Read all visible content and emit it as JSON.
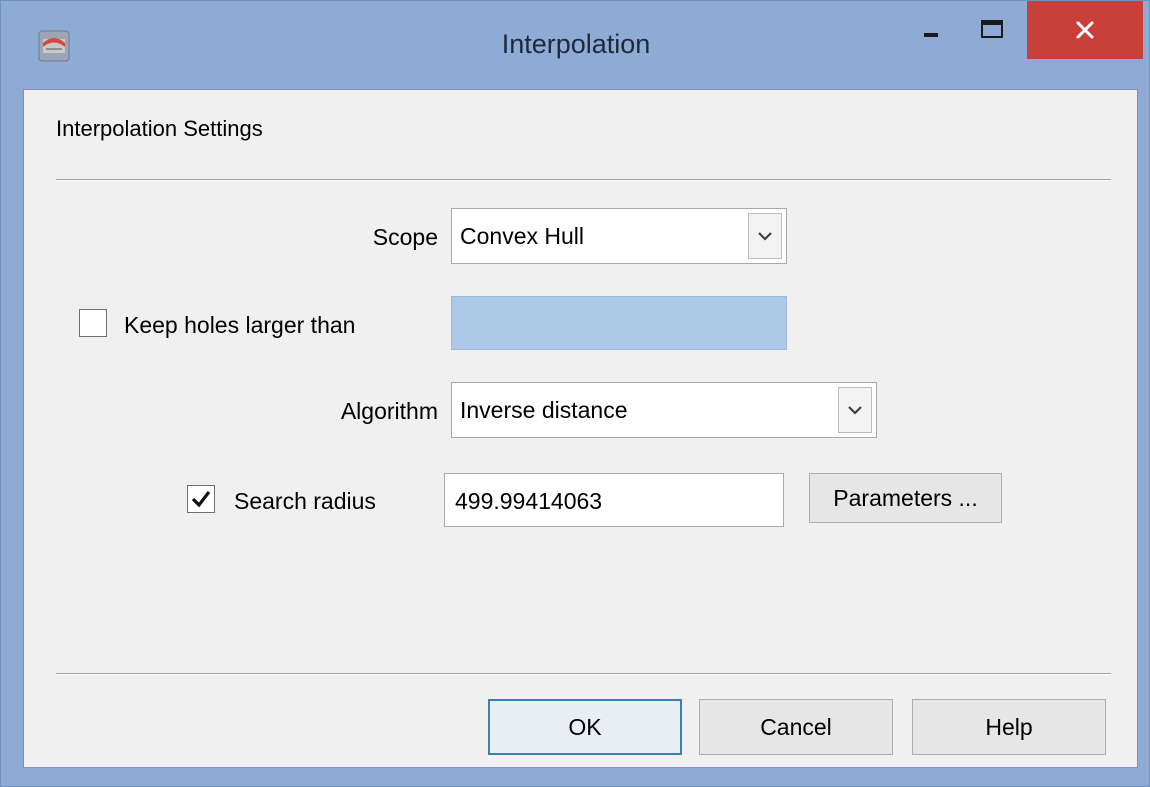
{
  "window": {
    "title": "Interpolation",
    "app_icon": "grid-app-icon",
    "controls": {
      "minimize_icon": "minimize-icon",
      "maximize_icon": "maximize-icon",
      "close_icon": "close-icon"
    }
  },
  "section": {
    "title": "Interpolation Settings"
  },
  "scope": {
    "label": "Scope",
    "value": "Convex Hull"
  },
  "keep_holes": {
    "label": "Keep holes larger than",
    "checked": false,
    "value": ""
  },
  "algorithm": {
    "label": "Algorithm",
    "value": "Inverse distance"
  },
  "search_radius": {
    "label": "Search radius",
    "checked": true,
    "value": "499.99414063"
  },
  "parameters_button": "Parameters ...",
  "buttons": {
    "ok": "OK",
    "cancel": "Cancel",
    "help": "Help"
  },
  "colors": {
    "title_bar": "#8eabd6",
    "close_button": "#c9403a",
    "dialog_bg": "#f0f0f0",
    "disabled_field": "#adc9e8",
    "default_button_border": "#3c7fb1"
  }
}
